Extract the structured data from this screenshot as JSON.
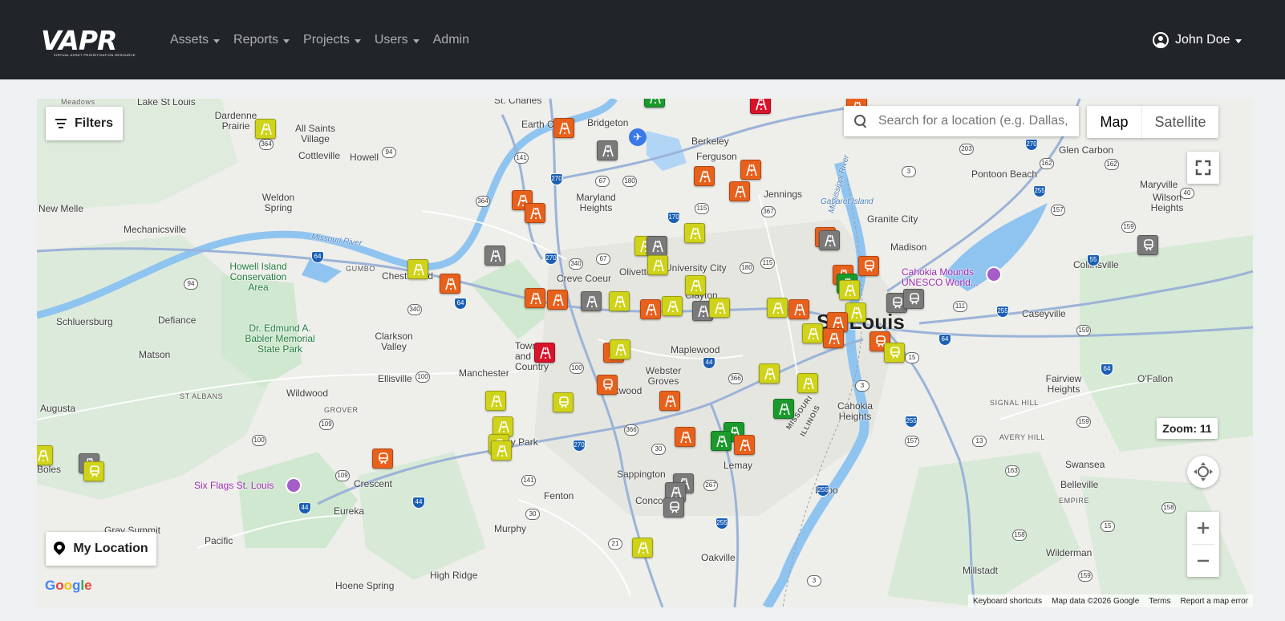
{
  "brand": {
    "name": "VAPR",
    "tagline": "VIRTUAL ASSET PRIORITIZATION RESOURCE"
  },
  "nav": [
    {
      "label": "Assets",
      "dropdown": true
    },
    {
      "label": "Reports",
      "dropdown": true
    },
    {
      "label": "Projects",
      "dropdown": true
    },
    {
      "label": "Users",
      "dropdown": true
    },
    {
      "label": "Admin",
      "dropdown": false
    }
  ],
  "user": {
    "name": "John Doe",
    "icon": "person-circle-icon"
  },
  "map": {
    "filters_label": "Filters",
    "search_placeholder": "Search for a location (e.g. Dallas, TX)",
    "map_type": {
      "map": "Map",
      "satellite": "Satellite",
      "selected": "Map"
    },
    "zoom_label": "Zoom: 11",
    "my_location_label": "My Location",
    "google_logo": "Google",
    "attribution": [
      "Keyboard shortcuts",
      "Map data ©2026 Google",
      "Terms",
      "Report a map error"
    ],
    "places": [
      "Meadows",
      "Lake St Louis",
      "Dardenne Prairie",
      "All Saints Village",
      "Cottleville",
      "Howell",
      "St. Charles",
      "Earth City",
      "Bridgeton",
      "Berkeley",
      "Ferguson",
      "Jennings",
      "Maryland Heights",
      "Weldon Spring",
      "New Melle",
      "Mechanicsville",
      "Howell Island Conservation Area",
      "GUMBO",
      "Chesterfield",
      "Creve Coeur",
      "Olivette",
      "University City",
      "Clayton",
      "Schluersburg",
      "Defiance",
      "Dr. Edmund A. Babler Memorial State Park",
      "Clarkson Valley",
      "Matson",
      "Town and Country",
      "Maplewood",
      "Manchester",
      "Ellisville",
      "Wildwood",
      "Webster Groves",
      "Kirkwood",
      "ST ALBANS",
      "GROVER",
      "Augusta",
      "Valley Park",
      "Boles",
      "Eureka",
      "Six Flags St. Louis",
      "Crescent",
      "Fenton",
      "Sappington",
      "Concord",
      "Lemay",
      "Murphy",
      "Pacific",
      "Gray Summit",
      "High Ridge",
      "Hoene Spring",
      "Oakville",
      "Gabaret Island",
      "Granite City",
      "Madison",
      "Pontoon Beach",
      "Glen Carbon",
      "Maryville",
      "Wilson Heights",
      "Collinsville",
      "Cahokia Mounds UNESCO World...",
      "Caseyville",
      "St. Louis",
      "Cahokia Heights",
      "Fairview Heights",
      "O'Fallon",
      "SIGNAL HILL",
      "AVERY HILL",
      "Swansea",
      "Belleville",
      "EMPIRE",
      "Dupo",
      "Millstadt",
      "Wilderman",
      "MISSOURI",
      "ILLINOIS",
      "Missouri River",
      "Mississippi River"
    ]
  },
  "markers": {
    "colors": {
      "orange": "#e8611c",
      "yellow": "#cfd31a",
      "gray": "#7a7a7a",
      "red": "#d9142a",
      "green": "#1b9a2c"
    },
    "icons": [
      "bridge-icon",
      "tunnel-icon"
    ]
  }
}
